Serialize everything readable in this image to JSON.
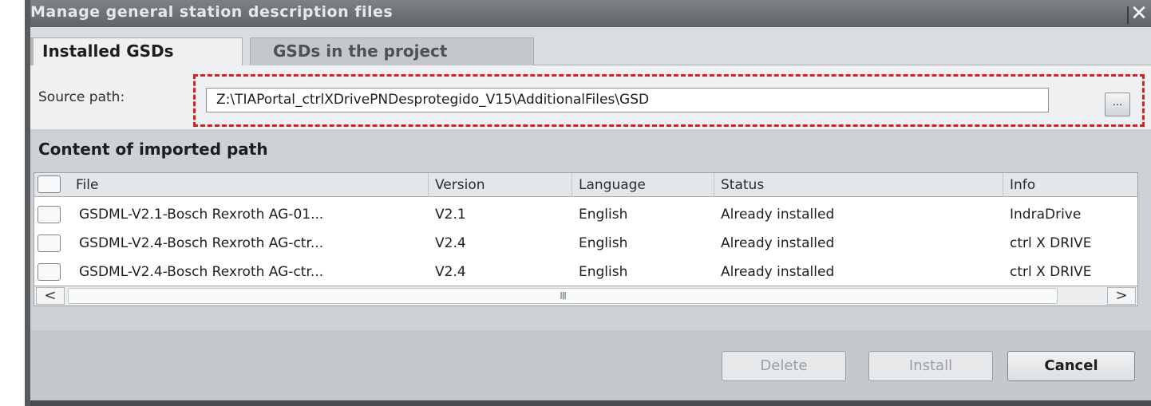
{
  "window": {
    "title": "Manage general station description files",
    "close_icon": "close-icon"
  },
  "tabs": [
    {
      "label": "Installed GSDs",
      "active": true
    },
    {
      "label": "GSDs in the project",
      "active": false
    }
  ],
  "source": {
    "label": "Source path:",
    "value": "Z:\\TIAPortal_ctrlXDrivePNDesprotegido_V15\\AdditionalFiles\\GSD",
    "browse_label": "..."
  },
  "content": {
    "title": "Content of imported path",
    "columns": [
      "File",
      "Version",
      "Language",
      "Status",
      "Info"
    ],
    "rows": [
      {
        "file": "GSDML-V2.1-Bosch Rexroth AG-01...",
        "version": "V2.1",
        "language": "English",
        "status": "Already installed",
        "info": "IndraDrive"
      },
      {
        "file": "GSDML-V2.4-Bosch Rexroth AG-ctr...",
        "version": "V2.4",
        "language": "English",
        "status": "Already installed",
        "info": "ctrl X DRIVE"
      },
      {
        "file": "GSDML-V2.4-Bosch Rexroth AG-ctr...",
        "version": "V2.4",
        "language": "English",
        "status": "Already installed",
        "info": "ctrl X DRIVE"
      }
    ]
  },
  "scrollbar": {
    "left_arrow": "<",
    "right_arrow": ">",
    "grip": "III"
  },
  "buttons": {
    "delete": "Delete",
    "install": "Install",
    "cancel": "Cancel"
  },
  "colors": {
    "highlight_dash": "#d92020",
    "titlebar": "#6b7074",
    "dialog_bg": "#cdd2d6"
  }
}
